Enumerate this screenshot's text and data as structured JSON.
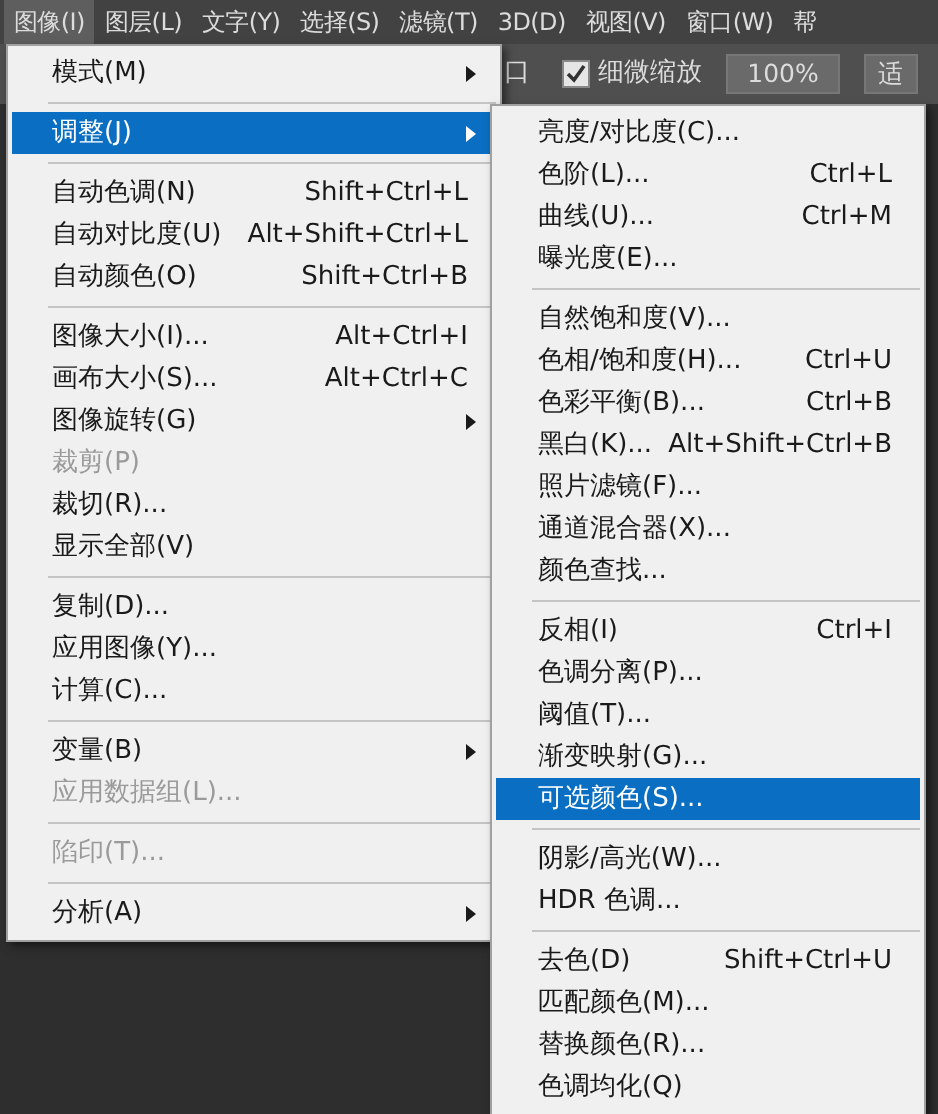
{
  "menu_bar": [
    {
      "label": "图像(I)",
      "selected": true
    },
    {
      "label": "图层(L)",
      "selected": false
    },
    {
      "label": "文字(Y)",
      "selected": false
    },
    {
      "label": "选择(S)",
      "selected": false
    },
    {
      "label": "滤镜(T)",
      "selected": false
    },
    {
      "label": "3D(D)",
      "selected": false
    },
    {
      "label": "视图(V)",
      "selected": false
    },
    {
      "label": "窗口(W)",
      "selected": false
    },
    {
      "label": "帮",
      "selected": false
    }
  ],
  "options_bar": {
    "partial_label": "口",
    "checkbox": {
      "label": "细微缩放",
      "checked": true
    },
    "zoom_field": "100%",
    "fit_button": "适"
  },
  "image_menu": [
    {
      "kind": "submenu",
      "label": "模式(M)",
      "selected": false,
      "disabled": false
    },
    {
      "kind": "separator"
    },
    {
      "kind": "submenu",
      "label": "调整(J)",
      "selected": true,
      "disabled": false
    },
    {
      "kind": "separator"
    },
    {
      "kind": "item",
      "label": "自动色调(N)",
      "shortcut": "Shift+Ctrl+L",
      "selected": false,
      "disabled": false
    },
    {
      "kind": "item",
      "label": "自动对比度(U)",
      "shortcut": "Alt+Shift+Ctrl+L",
      "selected": false,
      "disabled": false
    },
    {
      "kind": "item",
      "label": "自动颜色(O)",
      "shortcut": "Shift+Ctrl+B",
      "selected": false,
      "disabled": false
    },
    {
      "kind": "separator"
    },
    {
      "kind": "item",
      "label": "图像大小(I)...",
      "shortcut": "Alt+Ctrl+I",
      "selected": false,
      "disabled": false
    },
    {
      "kind": "item",
      "label": "画布大小(S)...",
      "shortcut": "Alt+Ctrl+C",
      "selected": false,
      "disabled": false
    },
    {
      "kind": "submenu",
      "label": "图像旋转(G)",
      "selected": false,
      "disabled": false
    },
    {
      "kind": "item",
      "label": "裁剪(P)",
      "selected": false,
      "disabled": true
    },
    {
      "kind": "item",
      "label": "裁切(R)...",
      "selected": false,
      "disabled": false
    },
    {
      "kind": "item",
      "label": "显示全部(V)",
      "selected": false,
      "disabled": false
    },
    {
      "kind": "separator"
    },
    {
      "kind": "item",
      "label": "复制(D)...",
      "selected": false,
      "disabled": false
    },
    {
      "kind": "item",
      "label": "应用图像(Y)...",
      "selected": false,
      "disabled": false
    },
    {
      "kind": "item",
      "label": "计算(C)...",
      "selected": false,
      "disabled": false
    },
    {
      "kind": "separator"
    },
    {
      "kind": "submenu",
      "label": "变量(B)",
      "selected": false,
      "disabled": false
    },
    {
      "kind": "item",
      "label": "应用数据组(L)...",
      "selected": false,
      "disabled": true
    },
    {
      "kind": "separator"
    },
    {
      "kind": "item",
      "label": "陷印(T)...",
      "selected": false,
      "disabled": true
    },
    {
      "kind": "separator"
    },
    {
      "kind": "submenu",
      "label": "分析(A)",
      "selected": false,
      "disabled": false
    }
  ],
  "adjustments_submenu": [
    {
      "kind": "item",
      "label": "亮度/对比度(C)...",
      "selected": false,
      "disabled": false
    },
    {
      "kind": "item",
      "label": "色阶(L)...",
      "shortcut": "Ctrl+L",
      "selected": false,
      "disabled": false
    },
    {
      "kind": "item",
      "label": "曲线(U)...",
      "shortcut": "Ctrl+M",
      "selected": false,
      "disabled": false
    },
    {
      "kind": "item",
      "label": "曝光度(E)...",
      "selected": false,
      "disabled": false
    },
    {
      "kind": "separator"
    },
    {
      "kind": "item",
      "label": "自然饱和度(V)...",
      "selected": false,
      "disabled": false
    },
    {
      "kind": "item",
      "label": "色相/饱和度(H)...",
      "shortcut": "Ctrl+U",
      "selected": false,
      "disabled": false
    },
    {
      "kind": "item",
      "label": "色彩平衡(B)...",
      "shortcut": "Ctrl+B",
      "selected": false,
      "disabled": false
    },
    {
      "kind": "item",
      "label": "黑白(K)...",
      "shortcut": "Alt+Shift+Ctrl+B",
      "selected": false,
      "disabled": false
    },
    {
      "kind": "item",
      "label": "照片滤镜(F)...",
      "selected": false,
      "disabled": false
    },
    {
      "kind": "item",
      "label": "通道混合器(X)...",
      "selected": false,
      "disabled": false
    },
    {
      "kind": "item",
      "label": "颜色查找...",
      "selected": false,
      "disabled": false
    },
    {
      "kind": "separator"
    },
    {
      "kind": "item",
      "label": "反相(I)",
      "shortcut": "Ctrl+I",
      "selected": false,
      "disabled": false
    },
    {
      "kind": "item",
      "label": "色调分离(P)...",
      "selected": false,
      "disabled": false
    },
    {
      "kind": "item",
      "label": "阈值(T)...",
      "selected": false,
      "disabled": false
    },
    {
      "kind": "item",
      "label": "渐变映射(G)...",
      "selected": false,
      "disabled": false
    },
    {
      "kind": "item",
      "label": "可选颜色(S)...",
      "selected": true,
      "disabled": false
    },
    {
      "kind": "separator"
    },
    {
      "kind": "item",
      "label": "阴影/高光(W)...",
      "selected": false,
      "disabled": false
    },
    {
      "kind": "item",
      "label": "HDR 色调...",
      "selected": false,
      "disabled": false
    },
    {
      "kind": "separator"
    },
    {
      "kind": "item",
      "label": "去色(D)",
      "shortcut": "Shift+Ctrl+U",
      "selected": false,
      "disabled": false
    },
    {
      "kind": "item",
      "label": "匹配颜色(M)...",
      "selected": false,
      "disabled": false
    },
    {
      "kind": "item",
      "label": "替换颜色(R)...",
      "selected": false,
      "disabled": false
    },
    {
      "kind": "item",
      "label": "色调均化(Q)",
      "selected": false,
      "disabled": false
    }
  ]
}
